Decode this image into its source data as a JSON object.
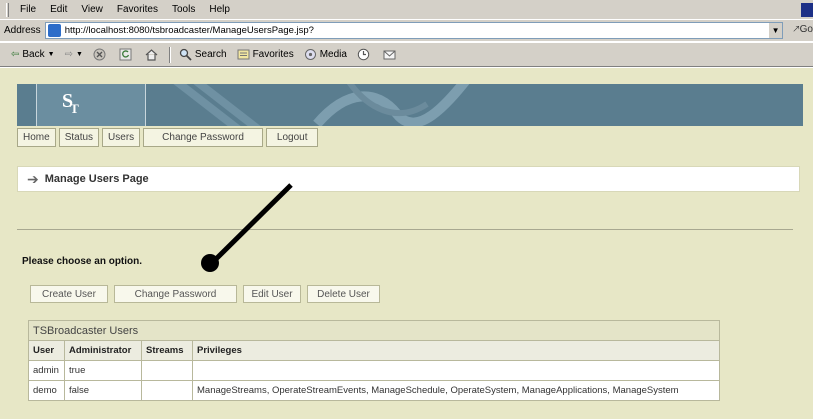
{
  "menu": [
    "File",
    "Edit",
    "View",
    "Favorites",
    "Tools",
    "Help"
  ],
  "address": {
    "label": "Address",
    "url": "http://localhost:8080/tsbroadcaster/ManageUsersPage.jsp?",
    "go": "Go"
  },
  "toolbar": {
    "back": "Back",
    "search": "Search",
    "favorites": "Favorites",
    "media": "Media"
  },
  "nav": [
    "Home",
    "Status",
    "Users",
    "Change Password",
    "Logout"
  ],
  "page_title": "Manage Users Page",
  "prompt": "Please choose an option.",
  "actions": [
    "Create User",
    "Change Password",
    "Edit User",
    "Delete User"
  ],
  "users_table": {
    "caption": "TSBroadcaster Users",
    "headers": [
      "User",
      "Administrator",
      "Streams",
      "Privileges"
    ],
    "rows": [
      [
        "admin",
        "true",
        "",
        ""
      ],
      [
        "demo",
        "false",
        "",
        "ManageStreams, OperateStreamEvents, ManageSchedule, OperateSystem, ManageApplications, ManageSystem"
      ]
    ]
  },
  "colors": {
    "page_bg": "#e7e7c6",
    "banner": "#5a7d8f",
    "chrome": "#d4d0c8"
  }
}
